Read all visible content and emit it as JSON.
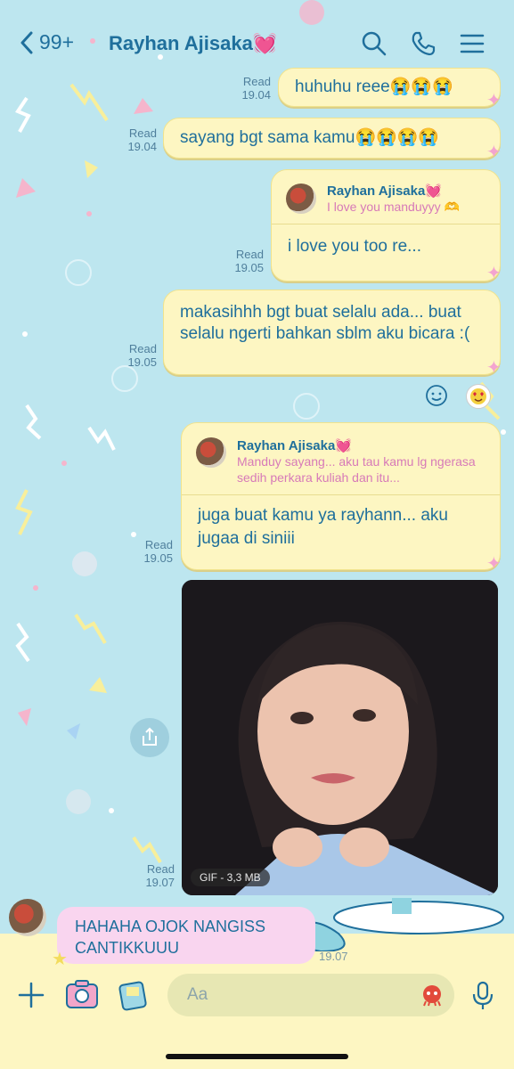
{
  "header": {
    "back_count": "99+",
    "contact_name": "Rayhan Ajisaka💓"
  },
  "messages": [
    {
      "status": "Read",
      "time": "19.04",
      "text": "huhuhu reee😭😭😭"
    },
    {
      "status": "Read",
      "time": "19.04",
      "text": "sayang bgt sama kamu😭😭😭😭"
    },
    {
      "status": "Read",
      "time": "19.05",
      "quote_name": "Rayhan Ajisaka💓",
      "quote_text": "I love you manduyyy 🫶",
      "text": "i love you too re..."
    },
    {
      "status": "Read",
      "time": "19.05",
      "text": "makasihhh bgt buat selalu ada... buat selalu ngerti bahkan sblm aku bicara :("
    },
    {
      "status": "Read",
      "time": "19.05",
      "quote_name": "Rayhan Ajisaka💓",
      "quote_text": "Manduy sayang... aku tau kamu lg ngerasa sedih perkara kuliah dan itu...",
      "text": "juga buat kamu ya rayhann... aku jugaa di siniii"
    },
    {
      "status": "Read",
      "time": "19.07",
      "gif_label": "GIF - 3,3 MB"
    }
  ],
  "incoming": {
    "text": "HAHAHA OJOK NANGISS CANTIKKUUU",
    "time": "19.07"
  },
  "composer": {
    "placeholder": "Aa"
  },
  "colors": {
    "accent": "#1f6f9c",
    "bubble_out": "#fdf6c2",
    "bubble_in": "#f9d5ef",
    "background": "#bde6ef"
  }
}
